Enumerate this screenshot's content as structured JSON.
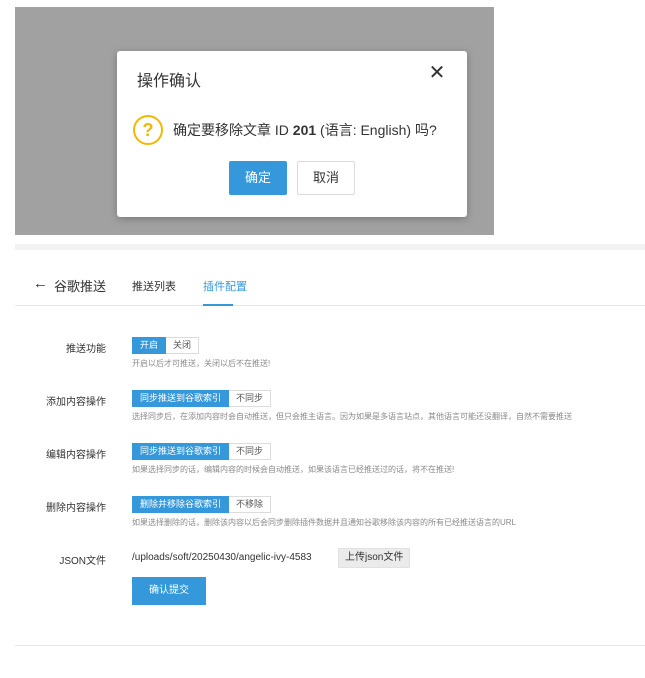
{
  "dialog": {
    "title": "操作确认",
    "close_glyph": "✕",
    "icon_glyph": "?",
    "msg_before": "确定要移除文章 ID ",
    "msg_id": "201",
    "msg_after": " (语言: English) 吗?",
    "ok_label": "确定",
    "cancel_label": "取消"
  },
  "header": {
    "back_glyph": "←",
    "title": "谷歌推送",
    "tabs": [
      {
        "label": "推送列表",
        "active": false
      },
      {
        "label": "插件配置",
        "active": true
      }
    ]
  },
  "settings": {
    "push": {
      "label": "推送功能",
      "on": "开启",
      "off": "关闭",
      "hint": "开启以后才可推送，关闭以后不在推送!"
    },
    "add": {
      "label": "添加内容操作",
      "on": "同步推送到谷歌索引",
      "off": "不同步",
      "hint": "选择同步后，在添加内容时会自动推送，但只会推主语言。因为如果是多语言站点，其他语言可能还没翻译，自然不需要推送"
    },
    "edit": {
      "label": "编辑内容操作",
      "on": "同步推送到谷歌索引",
      "off": "不同步",
      "hint": "如果选择同步的话，编辑内容的时候会自动推送，如果该语言已经推送过的话，将不在推送!"
    },
    "delete": {
      "label": "删除内容操作",
      "on": "删除并移除谷歌索引",
      "off": "不移除",
      "hint": "如果选择删除的话，删除该内容以后会同步删除插件数据并且通知谷歌移除该内容的所有已经推送语言的URL"
    },
    "json": {
      "label": "JSON文件",
      "path": "/uploads/soft/20250430/angelic-ivy-4583",
      "upload_label": "上传json文件"
    },
    "submit_label": "确认提交"
  },
  "colors": {
    "accent": "#3598db",
    "warning": "#f5b800",
    "overlay": "#a1a1a1"
  }
}
